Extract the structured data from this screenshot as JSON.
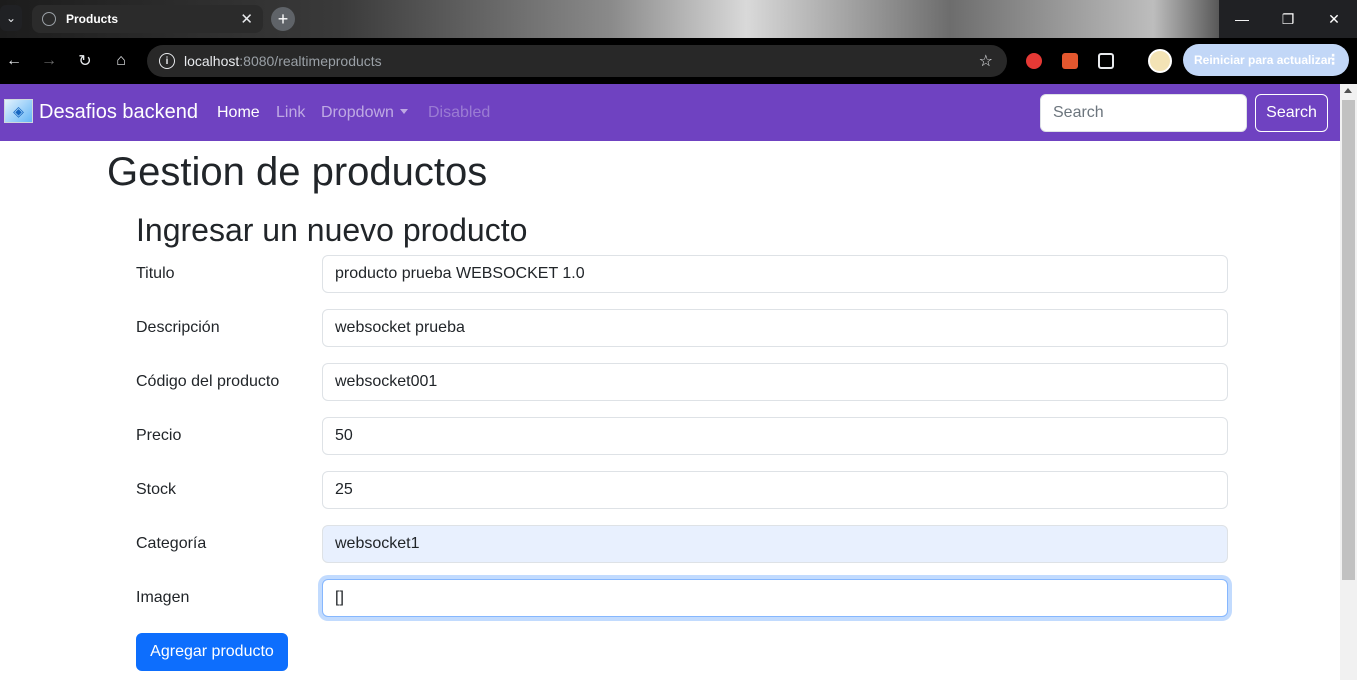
{
  "browser": {
    "tab_title": "Products",
    "url_host": "localhost",
    "url_path": ":8080/realtimeproducts",
    "update_button": "Reiniciar para actualizar"
  },
  "navbar": {
    "brand": "Desafios backend",
    "links": [
      {
        "label": "Home",
        "state": "active"
      },
      {
        "label": "Link",
        "state": "normal"
      },
      {
        "label": "Dropdown",
        "state": "normal"
      },
      {
        "label": "Disabled",
        "state": "disabled"
      }
    ],
    "search_placeholder": "Search",
    "search_button": "Search",
    "color": "#6f42c1"
  },
  "page": {
    "title": "Gestion de productos",
    "form_title": "Ingresar un nuevo producto",
    "fields": [
      {
        "label": "Titulo",
        "value": "producto prueba WEBSOCKET 1.0"
      },
      {
        "label": "Descripción",
        "value": "websocket prueba"
      },
      {
        "label": "Código del producto",
        "value": "websocket001"
      },
      {
        "label": "Precio",
        "value": "50"
      },
      {
        "label": "Stock",
        "value": "25"
      },
      {
        "label": "Categoría",
        "value": "websocket1"
      },
      {
        "label": "Imagen",
        "value": "[]"
      }
    ],
    "submit_button": "Agregar producto",
    "primary_color": "#0d6efd"
  }
}
